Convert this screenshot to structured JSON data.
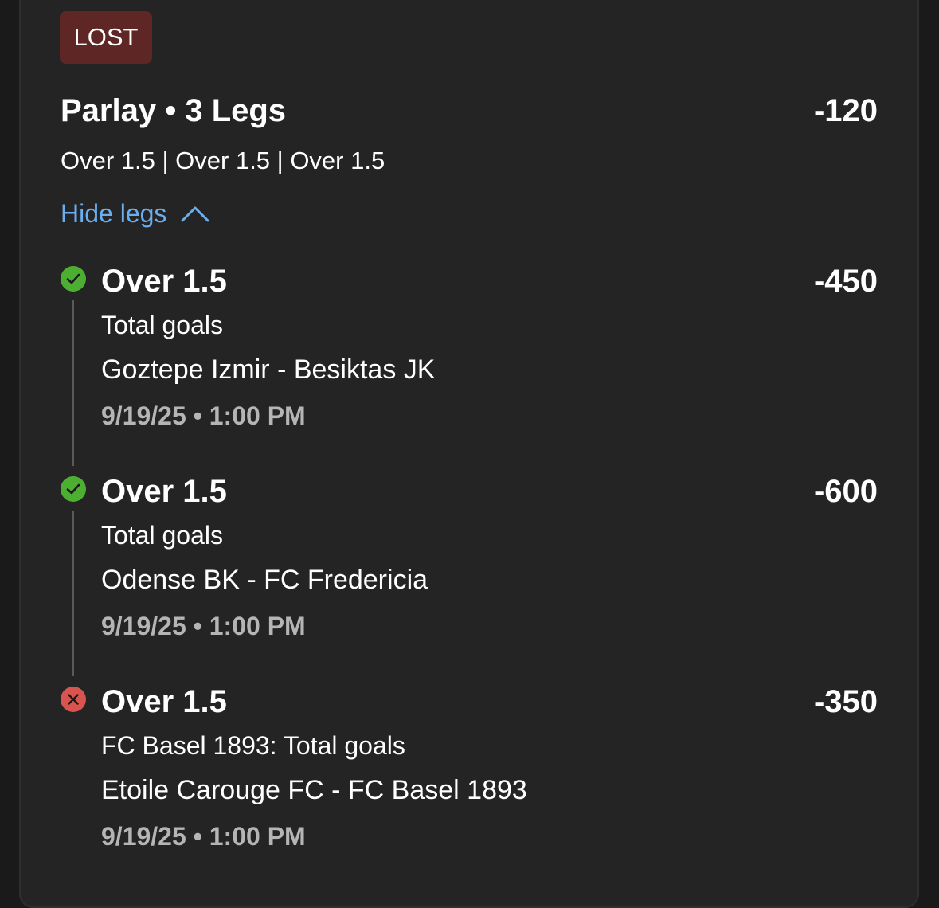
{
  "bet": {
    "status": "LOST",
    "title": "Parlay • 3 Legs",
    "odds": "-120",
    "selections": "Over 1.5 | Over 1.5 | Over 1.5",
    "toggle_label": "Hide legs",
    "colors": {
      "status_bg": "#5e2624",
      "link": "#6aaef0",
      "won": "#4caf32",
      "lost": "#d9534f"
    }
  },
  "legs": [
    {
      "result": "won",
      "icon": "check-circle-icon",
      "title": "Over 1.5",
      "odds": "-450",
      "market": "Total goals",
      "event": "Goztepe Izmir - Besiktas JK",
      "time": "9/19/25 • 1:00 PM"
    },
    {
      "result": "won",
      "icon": "check-circle-icon",
      "title": "Over 1.5",
      "odds": "-600",
      "market": "Total goals",
      "event": "Odense BK - FC Fredericia",
      "time": "9/19/25 • 1:00 PM"
    },
    {
      "result": "lost",
      "icon": "x-circle-icon",
      "title": "Over 1.5",
      "odds": "-350",
      "market": "FC Basel 1893: Total goals",
      "event": "Etoile Carouge FC - FC Basel 1893",
      "time": "9/19/25 • 1:00 PM"
    }
  ]
}
